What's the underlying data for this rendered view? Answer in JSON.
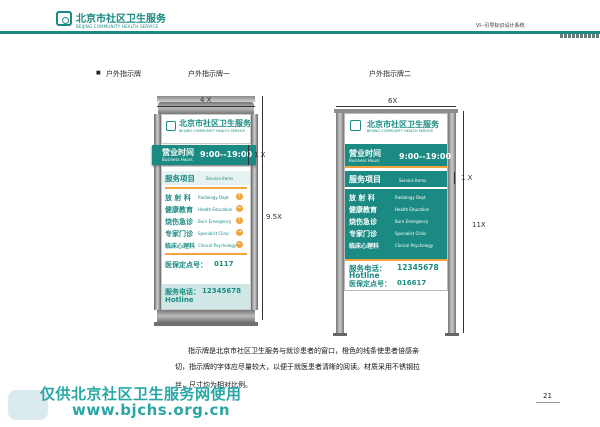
{
  "header": {
    "title": "北京市社区卫生服务",
    "subtitle": "BEIJING COMMUNITY HEALTH SERVICE",
    "system_name": "VI--引导标识设计系统"
  },
  "section": {
    "bullet": "■",
    "title": "户外指示牌",
    "sign1_label": "户外指示牌一",
    "sign2_label": "户外指示牌二"
  },
  "sign": {
    "org_cn": "北京市社区卫生服务",
    "org_en": "BEIJING COMMUNITY HEALTH SERVICE",
    "hours_cn": "营业时间",
    "hours_en": "Business Hours",
    "hours_value": "9:00--19:00",
    "services_cn": "服务项目",
    "services_en": "Service Items",
    "items": [
      {
        "cn": "放 射 科",
        "en": "Radiology Dept."
      },
      {
        "cn": "健康教育",
        "en": "Health Education"
      },
      {
        "cn": "烧伤急诊",
        "en": "Burn Emergency"
      },
      {
        "cn": "专家门诊",
        "en": "Specialist Clinic"
      },
      {
        "cn": "临床心理科",
        "en": "Clinical Psychology"
      }
    ],
    "insurance_label": "医保定点号：",
    "insurance1": "0117",
    "insurance2": "016617",
    "phone_label": "服务电话：",
    "phone": "12345678",
    "hotline": "Hotline"
  },
  "dims": {
    "s1_width": "4 X",
    "s1_height": "9.5X",
    "s1_band": "1 X",
    "s2_width": "6X",
    "s2_height": "11X",
    "s2_band": "1 X"
  },
  "description": {
    "line1": "指示牌是北京市社区卫生服务与就诊患者的窗口，橙色的线条使患者倍感亲",
    "line2": "切，指示牌的字体应尽量较大，以便于就医患者清晰的阅读。材质采用不锈钢拉",
    "line3": "丝，尺寸均为相对比例。"
  },
  "page_number": "21",
  "watermark": {
    "line1": "仅供北京社区卫生服务网使用",
    "line2": "www.bjchs.org.cn"
  },
  "colors": {
    "teal": "#1b8a82",
    "orange": "#f2a33a",
    "steel": "#9fa2a4"
  }
}
